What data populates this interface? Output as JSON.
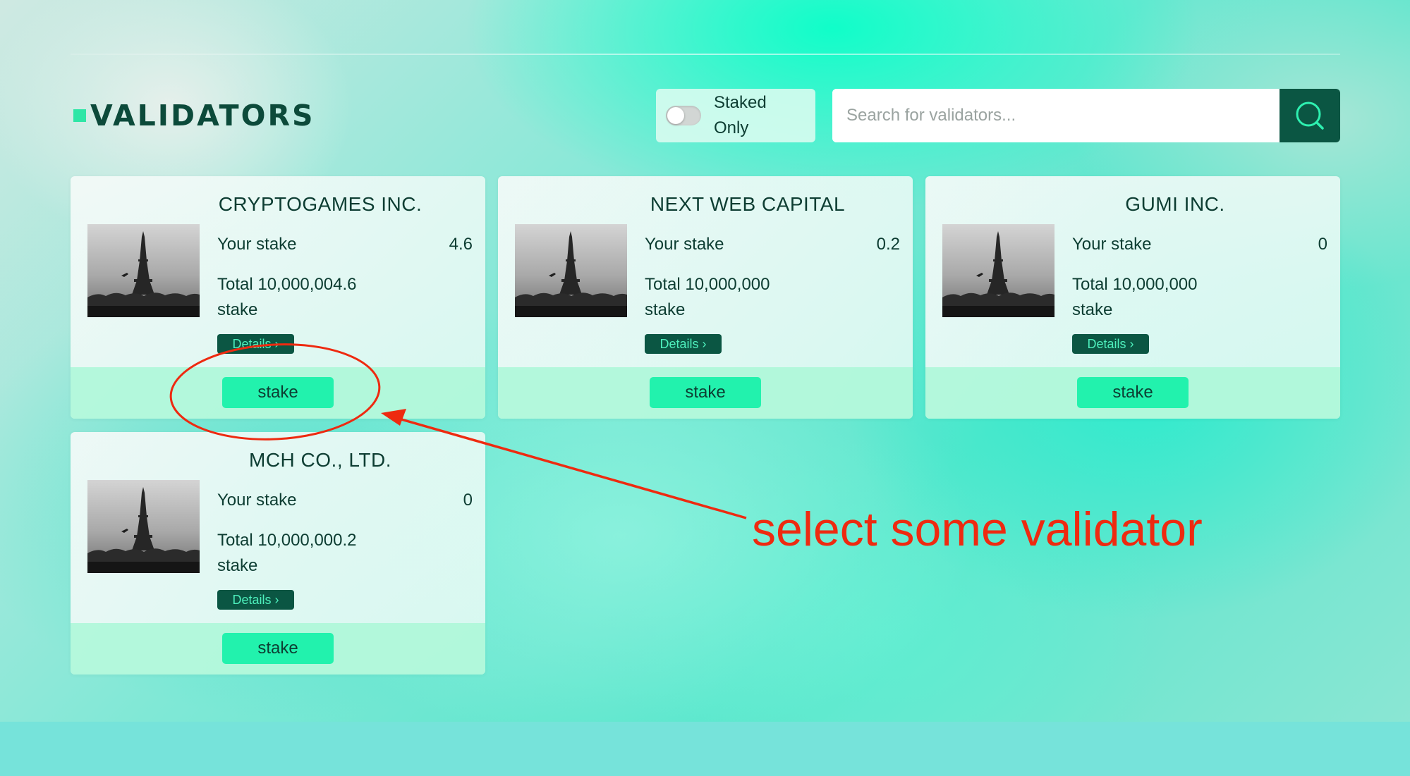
{
  "header": {
    "title": "VALIDATORS",
    "toggle": {
      "label": "Staked Only",
      "checked": false
    },
    "search": {
      "placeholder": "Search for validators..."
    }
  },
  "validators": [
    {
      "name": "CRYPTOGAMES INC.",
      "your_stake_label": "Your stake",
      "your_stake": "4.6",
      "total_stake": "Total 10,000,004.6 stake",
      "details_label": "Details ›",
      "stake_label": "stake"
    },
    {
      "name": "NEXT WEB CAPITAL",
      "your_stake_label": "Your stake",
      "your_stake": "0.2",
      "total_stake": "Total 10,000,000 stake",
      "details_label": "Details ›",
      "stake_label": "stake"
    },
    {
      "name": "GUMI INC.",
      "your_stake_label": "Your stake",
      "your_stake": "0",
      "total_stake": "Total 10,000,000 stake",
      "details_label": "Details ›",
      "stake_label": "stake"
    },
    {
      "name": "MCH CO., LTD.",
      "your_stake_label": "Your stake",
      "your_stake": "0",
      "total_stake": "Total 10,000,000.2 stake",
      "details_label": "Details ›",
      "stake_label": "stake"
    }
  ],
  "annotation": {
    "text": "select some validator",
    "color": "#ee2a10"
  },
  "colors": {
    "brand_dark": "#0b5643",
    "accent": "#22f2ad",
    "text": "#0d3d32"
  }
}
